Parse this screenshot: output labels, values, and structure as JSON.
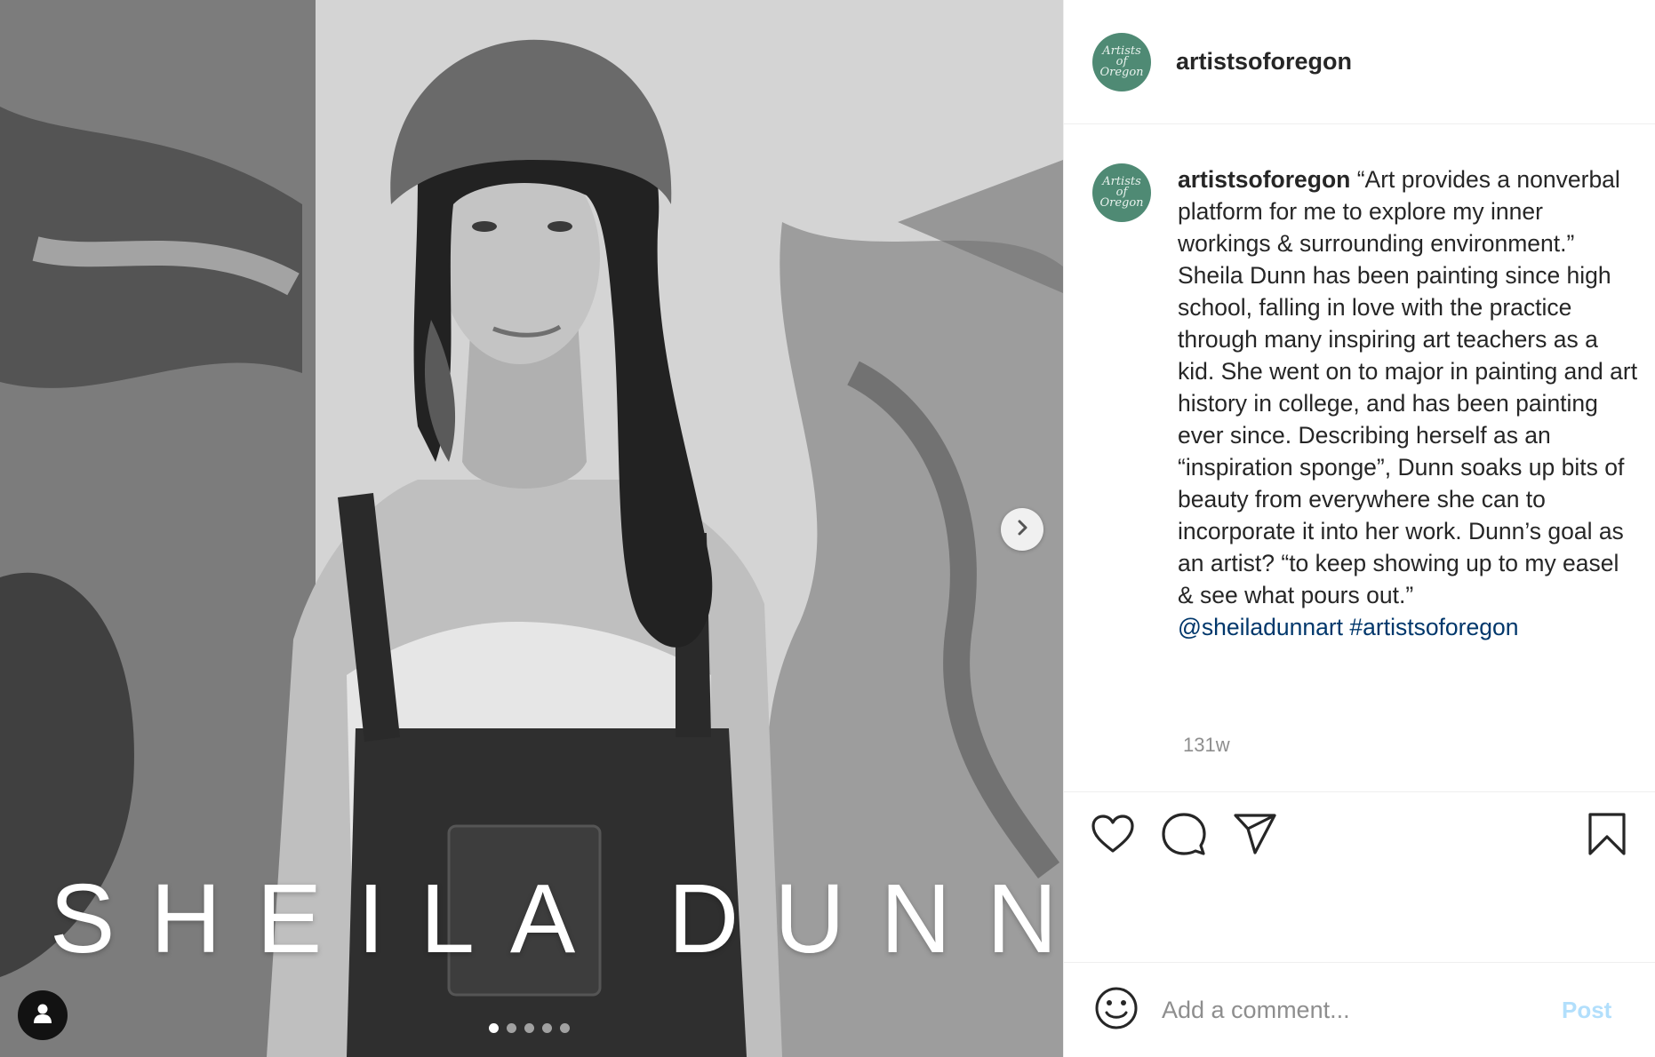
{
  "post": {
    "overlay_text": "SHEILA DUNN",
    "carousel_count": 5,
    "carousel_active_index": 0
  },
  "header": {
    "username": "artistsoforegon",
    "avatar_text": "Artists of Oregon"
  },
  "caption": {
    "username": "artistsoforegon",
    "quote": "“Art provides a nonverbal platform for me to explore my inner workings & surrounding environment.”",
    "body": "Sheila Dunn has been painting since high school, falling in love with the practice through many inspiring art teachers as a kid. She went on to major in painting and art history in college, and has been painting ever since. Describing herself as an “inspiration sponge”, Dunn soaks up bits of beauty from everywhere she can to incorporate it into her work. Dunn’s goal as an artist? “to keep showing up to my easel & see what pours out.”",
    "mention": "@sheiladunnart",
    "hashtag": "#artistsoforegon",
    "timestamp": "131w"
  },
  "comment": {
    "placeholder": "Add a comment...",
    "post_label": "Post"
  },
  "icons": {
    "like": "heart-icon",
    "comment": "comment-icon",
    "share": "paper-plane-icon",
    "save": "bookmark-icon",
    "emoji": "smiley-icon",
    "next": "chevron-right-icon",
    "tags": "user-icon"
  },
  "colors": {
    "link": "#00376b",
    "muted": "#8e8e8e",
    "post_disabled": "#b2dffc",
    "avatar_bg": "#4f8a74"
  }
}
